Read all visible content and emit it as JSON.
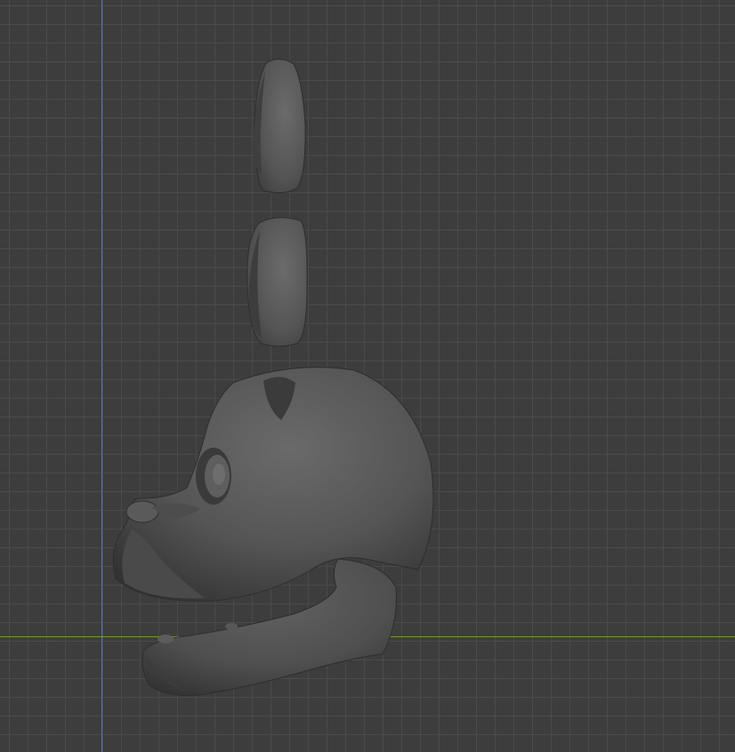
{
  "viewport": {
    "view": "orthographic-side",
    "grid": true,
    "axis_colors": {
      "vertical": "#5b74a3",
      "horizontal": "#6f9a2e"
    },
    "background_color": "#3d3d3d",
    "model_color": "#555555"
  },
  "scene": {
    "objects": [
      "ear-top-piece",
      "ear-bottom-piece",
      "head-shell",
      "eye",
      "snout",
      "lower-jaw"
    ]
  }
}
